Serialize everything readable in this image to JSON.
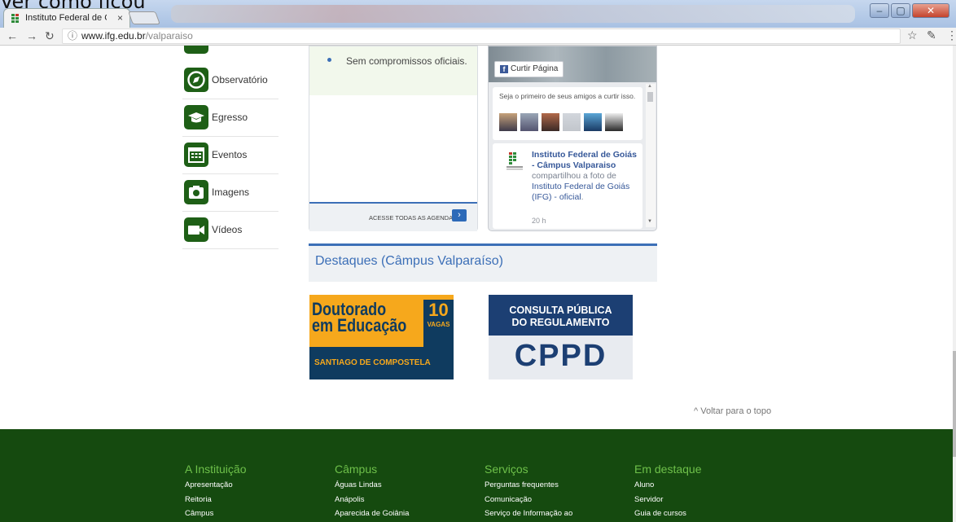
{
  "browser": {
    "tab_title": "Instituto Federal de Goiá",
    "tab_close": "×",
    "url_host": "www.ifg.edu.br",
    "url_path": "/valparaiso"
  },
  "overlay_text": "Ver como ficou",
  "sidebar": {
    "items": [
      {
        "label": "Observatório",
        "icon": "compass-icon"
      },
      {
        "label": "Egresso",
        "icon": "graduation-cap-icon"
      },
      {
        "label": "Eventos",
        "icon": "calendar-icon"
      },
      {
        "label": "Imagens",
        "icon": "camera-icon"
      },
      {
        "label": "Vídeos",
        "icon": "video-camera-icon"
      }
    ]
  },
  "agenda": {
    "item": "Sem compromissos oficiais.",
    "link": "ACESSE TODAS AS AGENDAS",
    "arrow": "›"
  },
  "facebook": {
    "like_button": "Curtir Página",
    "friends_text": "Seja o primeiro de seus amigos a curtir isso.",
    "post_author": "Instituto Federal de Goiás - Câmpus Valparaiso",
    "post_action": "compartilhou a foto de",
    "post_source": "Instituto Federal de Goiás (IFG) - oficial",
    "post_time": "20 h"
  },
  "destaques": {
    "title": "Destaques (Câmpus Valparaíso)",
    "banner1": {
      "line1": "Doutorado",
      "line2": "em Educação",
      "number": "10",
      "vagas": "VAGAS",
      "footer": "SANTIAGO DE COMPOSTELA"
    },
    "banner2": {
      "line1": "CONSULTA PÚBLICA",
      "line2": "DO REGULAMENTO",
      "big": "CPPD"
    }
  },
  "back_to_top": "Voltar para o topo",
  "footer": {
    "columns": [
      {
        "title": "A Instituição",
        "links": [
          "Apresentação",
          "Reitoria",
          "Câmpus"
        ]
      },
      {
        "title": "Câmpus",
        "links": [
          "Águas Lindas",
          "Anápolis",
          "Aparecida de Goiânia"
        ]
      },
      {
        "title": "Serviços",
        "links": [
          "Perguntas frequentes",
          "Comunicação",
          "Serviço de Informação ao"
        ]
      },
      {
        "title": "Em destaque",
        "links": [
          "Aluno",
          "Servidor",
          "Guia de cursos"
        ]
      }
    ]
  },
  "colors": {
    "primary_green": "#1e5f16",
    "footer_green": "#154a0f",
    "accent_blue": "#3c6fb7",
    "footer_heading": "#6ec04a"
  }
}
